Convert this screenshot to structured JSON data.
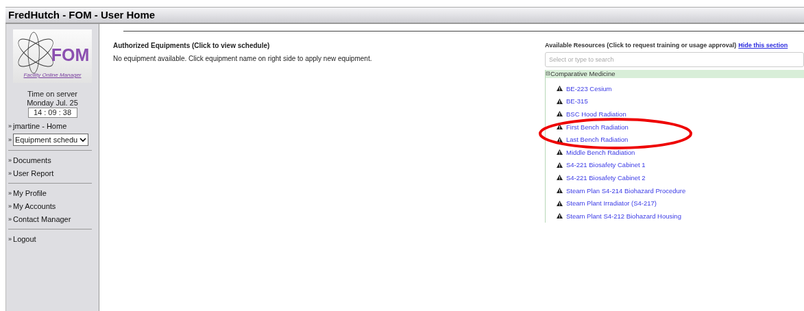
{
  "window": {
    "title": "FredHutch - FOM - User Home"
  },
  "sidebar": {
    "logo": {
      "title": "FOM",
      "subtitle": "Facility Online Manager"
    },
    "server_time": {
      "label": "Time on server",
      "date": "Monday Jul. 25",
      "time": "14 : 09 : 38"
    },
    "groups": [
      {
        "items": [
          {
            "kind": "link",
            "label": "jmartine - Home"
          },
          {
            "kind": "select",
            "label": "Equipment schedu"
          }
        ]
      },
      {
        "items": [
          {
            "kind": "link",
            "label": "Documents"
          },
          {
            "kind": "link",
            "label": "User Report"
          }
        ]
      },
      {
        "items": [
          {
            "kind": "link",
            "label": "My Profile"
          },
          {
            "kind": "link",
            "label": "My Accounts"
          },
          {
            "kind": "link",
            "label": "Contact Manager"
          }
        ]
      },
      {
        "items": [
          {
            "kind": "link",
            "label": "Logout"
          }
        ]
      }
    ],
    "bullet": "»"
  },
  "authorized": {
    "heading": "Authorized Equipments (Click to view schedule)",
    "message": "No equipment available. Click equipment name on right side to apply new equipment."
  },
  "resources": {
    "heading": "Available Resources (Click to request training or usage approval)",
    "hide_link": "Hide this section",
    "search": {
      "placeholder": "Select or type to search"
    },
    "groups": [
      {
        "name": "Comparative Medicine",
        "toggle": "⊟",
        "expanded": true,
        "items": [
          {
            "label": "BE-223 Cesium"
          },
          {
            "label": "BE-315"
          },
          {
            "label": "BSC Hood Radiation"
          },
          {
            "label": "First Bench Radiation"
          },
          {
            "label": "Last Bench Radiation"
          },
          {
            "label": "Middle Bench Radiation"
          },
          {
            "label": "S4-221 Biosafety Cabinet 1"
          },
          {
            "label": "S4-221 Biosafety Cabinet 2"
          },
          {
            "label": "Steam Plan S4-214 Biohazard Procedure"
          },
          {
            "label": "Steam Plant Irradiator (S4-217)"
          },
          {
            "label": "Steam Plant S4-212 Biohazard Housing"
          }
        ]
      }
    ]
  }
}
